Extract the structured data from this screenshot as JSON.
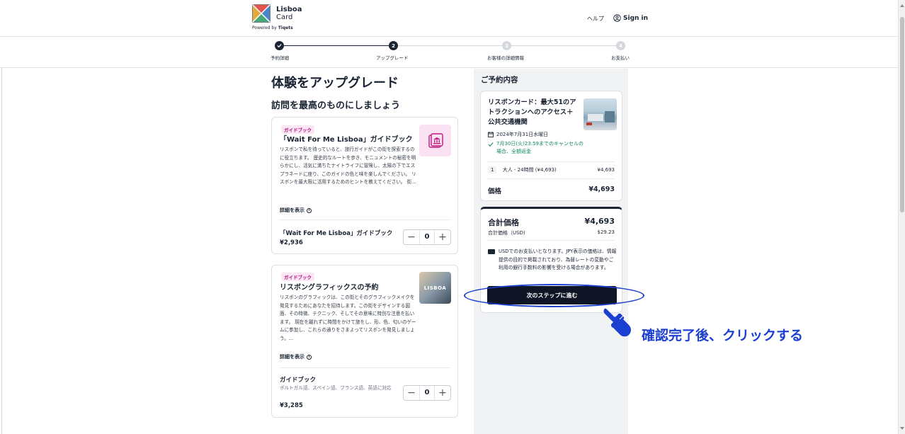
{
  "header": {
    "logo_title": "Lisboa",
    "logo_subtitle": "Card",
    "powered_by": "Powered by",
    "powered_brand": "Tiqets",
    "help": "ヘルプ",
    "sign_in": "Sign in"
  },
  "stepper": {
    "steps": [
      {
        "number": "",
        "label": "予約詳細",
        "state": "done"
      },
      {
        "number": "2",
        "label": "アップグレード",
        "state": "current"
      },
      {
        "number": "3",
        "label": "お客様の詳細情報",
        "state": "todo"
      },
      {
        "number": "4",
        "label": "お支払い",
        "state": "todo"
      }
    ]
  },
  "main": {
    "title": "体験をアップグレード",
    "subtitle": "訪問を最高のものにしましょう",
    "cards": [
      {
        "badge": "ガイドブック",
        "title": "「Wait For Me Lisboa」ガイドブック",
        "description": "リスボンで私を待っていると、旅行ガイドがこの街を探索するのに役立ちます。 歴史的なルートを歩き、モニュメントの秘密を明らかにし、活気に満ちたナイトライフに冒険し、太陽の下でエスプラネードに座り、このガイドの色と味を楽しんでください。 リスボンを最大限に活用するためのヒントを教えてください。 街...",
        "details": "詳細を表示",
        "option_name": "「Wait For Me Lisboa」ガイドブック",
        "option_sub": "",
        "price": "¥2,936",
        "quantity": "0"
      },
      {
        "badge": "ガイドブック",
        "title": "リスボングラフィックスの予約",
        "description": "リスボンのグラフィックは、この街とそのグラフィックメイクを発見するためにあなたを招待します。この街をデザインする図面、その特徴、テクニック、そしてその意味に特別な注意を払います。 現在を離れずに時間をかけて旅をし、形、色、匂いのゲームに参加し、これらの通りをさまよってリスボンを発見しましょう。...",
        "details": "詳細を表示",
        "option_name": "ガイドブック",
        "option_sub": "ポルトガル語、スペイン語、フランス語、英語に対応",
        "price": "¥3,285",
        "quantity": "0",
        "thumb_text": "LISBOA"
      }
    ]
  },
  "summary": {
    "heading": "ご予約内容",
    "product_title": "リスボンカード：最大51のアトラクションへのアクセス＋公共交通機関",
    "date": "2024年7月31日水曜日",
    "cancellation": "7月30日(火)23:59までのキャンセルの場合、全額返金",
    "line_qty": "1",
    "line_label": "大人 - 24時間 (¥4,693)",
    "line_price": "¥4,693",
    "price_label": "価格",
    "price_value": "¥4,693",
    "total_label": "合計価格",
    "total_value": "¥4,693",
    "total_usd_label": "合計価格（USD)",
    "total_usd_value": "$29.23",
    "note": "USDでのお支払いとなります。JPY表示の価格は、情報提供の目的で掲載されており、為替レートの変動やご利用の銀行手数料の影響を受ける場合があります。",
    "next_button": "次のステップに進む"
  },
  "annotation": {
    "text": "確認完了後、クリックする",
    "color": "#1b3fd0"
  },
  "colors": {
    "primary_dark": "#1b2433",
    "badge_pink": "#b0127a",
    "success_green": "#11895a"
  }
}
